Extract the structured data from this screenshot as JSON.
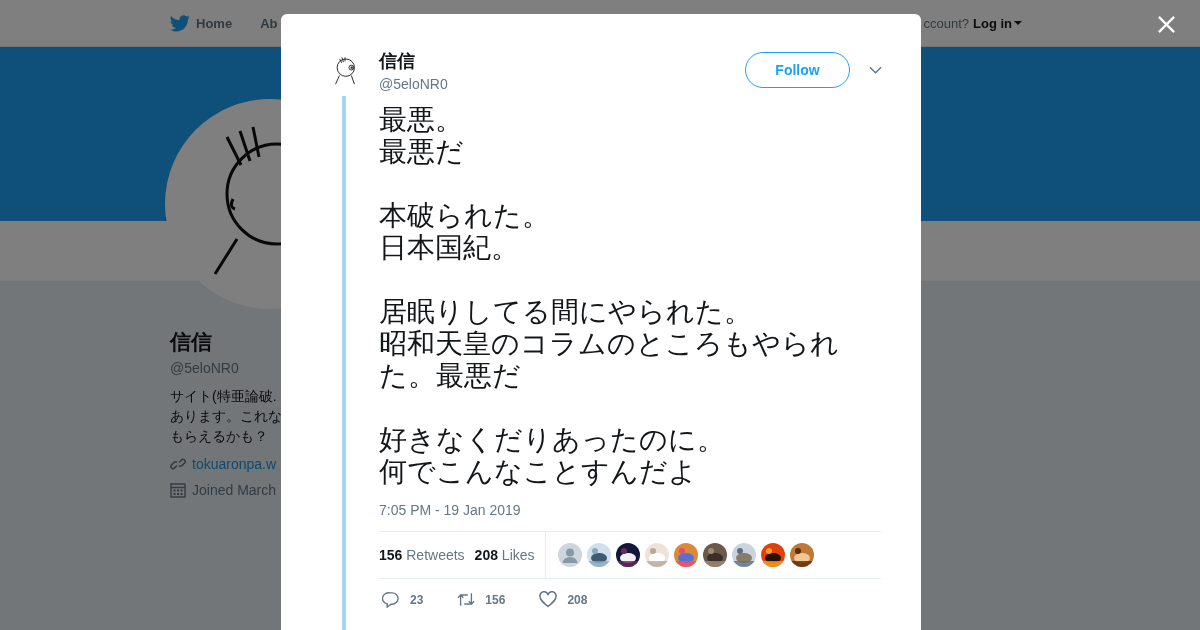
{
  "background_page": {
    "nav": [
      {
        "label": "Home",
        "kind": "home"
      },
      {
        "label": "Ab",
        "kind": "text"
      }
    ],
    "login": {
      "prompt": "ccount?",
      "label": "Log in"
    },
    "profile": {
      "name": "信信",
      "handle": "@5eloNR0",
      "bio_lines": [
        "サイト(特亜論破.",
        "あります。これな",
        "もらえるかも？"
      ],
      "link": "tokuaronpa.w",
      "joined": "Joined March"
    }
  },
  "modal": {
    "author": {
      "name": "信信",
      "handle": "@5eloNR0"
    },
    "follow_label": "Follow",
    "tweet_paragraphs": [
      [
        "最悪。",
        "最悪だ"
      ],
      [
        "本破られた。",
        "日本国紀。"
      ],
      [
        "居眠りしてる間にやられた。",
        "昭和天皇のコラムのところもやられた。最悪だ"
      ],
      [
        "好きなくだりあったのに。",
        "何でこんなことすんだよ"
      ]
    ],
    "timestamp": "7:05 PM - 19 Jan 2019",
    "stats": [
      {
        "count": "156",
        "label": "Retweets"
      },
      {
        "count": "208",
        "label": "Likes"
      }
    ],
    "liker_avatars": [
      {
        "kind": "default"
      },
      {
        "kind": "picture"
      },
      {
        "kind": "picture"
      },
      {
        "kind": "picture"
      },
      {
        "kind": "picture"
      },
      {
        "kind": "picture"
      },
      {
        "kind": "picture"
      },
      {
        "kind": "picture"
      },
      {
        "kind": "picture"
      }
    ],
    "actions": [
      {
        "kind": "reply",
        "count": "23"
      },
      {
        "kind": "retweet",
        "count": "156"
      },
      {
        "kind": "like",
        "count": "208"
      }
    ]
  }
}
